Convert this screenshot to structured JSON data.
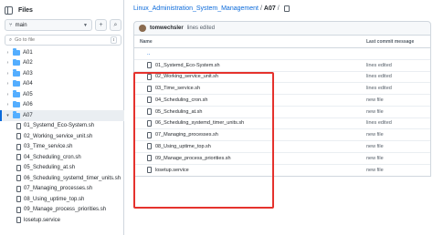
{
  "sidebar": {
    "title": "Files",
    "branch": "main",
    "add_symbol": "+",
    "search_symbol": "⌕",
    "goto_placeholder": "Go to file",
    "goto_shortcut": "t",
    "tree": [
      {
        "type": "folder",
        "label": "A01",
        "expanded": false
      },
      {
        "type": "folder",
        "label": "A02",
        "expanded": false
      },
      {
        "type": "folder",
        "label": "A03",
        "expanded": false
      },
      {
        "type": "folder",
        "label": "A04",
        "expanded": false
      },
      {
        "type": "folder",
        "label": "A05",
        "expanded": false
      },
      {
        "type": "folder",
        "label": "A06",
        "expanded": false
      },
      {
        "type": "folder",
        "label": "A07",
        "expanded": true,
        "active": true
      },
      {
        "type": "file",
        "label": "01_Systemd_Eco-System.sh"
      },
      {
        "type": "file",
        "label": "02_Working_service_unit.sh"
      },
      {
        "type": "file",
        "label": "03_Time_service.sh"
      },
      {
        "type": "file",
        "label": "04_Scheduling_cron.sh"
      },
      {
        "type": "file",
        "label": "05_Scheduling_at.sh"
      },
      {
        "type": "file",
        "label": "06_Scheduling_systemd_timer_units.sh"
      },
      {
        "type": "file",
        "label": "07_Managing_processes.sh"
      },
      {
        "type": "file",
        "label": "08_Using_uptime_top.sh"
      },
      {
        "type": "file",
        "label": "09_Manage_process_priorities.sh"
      },
      {
        "type": "file",
        "label": "losetup.service"
      }
    ]
  },
  "breadcrumb": {
    "repo": "Linux_Administration_System_Management",
    "separator": "/",
    "current": "A07",
    "trailing_separator": "/"
  },
  "commit": {
    "user": "tomwechsler",
    "message": "lines edited"
  },
  "table": {
    "col_name": "Name",
    "col_commit": "Last commit message",
    "parent_dir": "..",
    "rows": [
      {
        "name": "01_Systemd_Eco-System.sh",
        "commit": "lines edited"
      },
      {
        "name": "02_Working_service_unit.sh",
        "commit": "lines edited"
      },
      {
        "name": "03_Time_service.sh",
        "commit": "lines edited"
      },
      {
        "name": "04_Scheduling_cron.sh",
        "commit": "new file"
      },
      {
        "name": "05_Scheduling_at.sh",
        "commit": "new file"
      },
      {
        "name": "06_Scheduling_systemd_timer_units.sh",
        "commit": "lines edited"
      },
      {
        "name": "07_Managing_processes.sh",
        "commit": "new file"
      },
      {
        "name": "08_Using_uptime_top.sh",
        "commit": "new file"
      },
      {
        "name": "09_Manage_process_priorities.sh",
        "commit": "new file"
      },
      {
        "name": "losetup.service",
        "commit": "new file"
      }
    ]
  },
  "colors": {
    "link": "#0969da",
    "folder": "#54aeff",
    "highlight_box": "#e5322d"
  }
}
